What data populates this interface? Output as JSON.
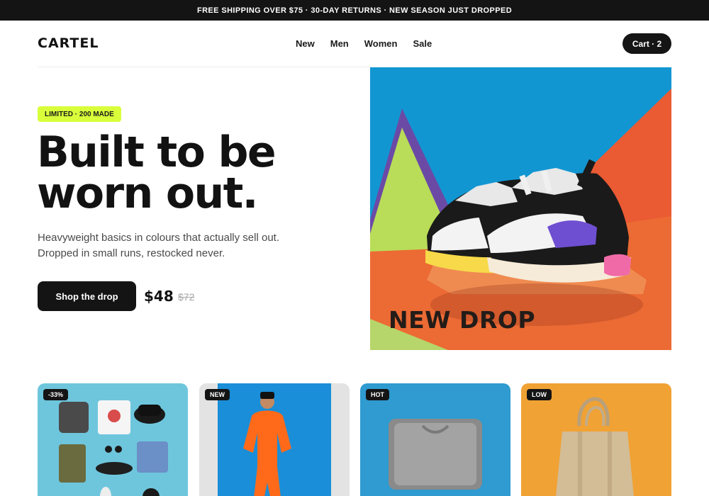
{
  "announcement": "FREE SHIPPING OVER $75 · 30-DAY RETURNS · NEW SEASON JUST DROPPED",
  "header": {
    "logo": "CARTEL",
    "nav": [
      "New",
      "Men",
      "Women",
      "Sale"
    ],
    "cart_label": "Cart · 2"
  },
  "hero": {
    "badge": "LIMITED · 200 MADE",
    "headline": [
      "Built to be",
      "worn out."
    ],
    "subtitle": [
      "Heavyweight basics in colours that actually sell out.",
      "Dropped in small runs, restocked never."
    ],
    "cta_label": "Shop the drop",
    "price": "$48",
    "price_was": "$72",
    "image_label": "NEW DROP"
  },
  "products": [
    {
      "tag": "-33%",
      "image": "flatlay-outfit"
    },
    {
      "tag": "NEW",
      "image": "orange-tracksuit-model"
    },
    {
      "tag": "HOT",
      "image": "grey-sweatshirt"
    },
    {
      "tag": "LOW",
      "image": "canvas-tote-bag"
    }
  ],
  "colors": {
    "announcement_bg": "#141414",
    "badge_lime": "#d8ff3a",
    "button_dark": "#141414"
  }
}
